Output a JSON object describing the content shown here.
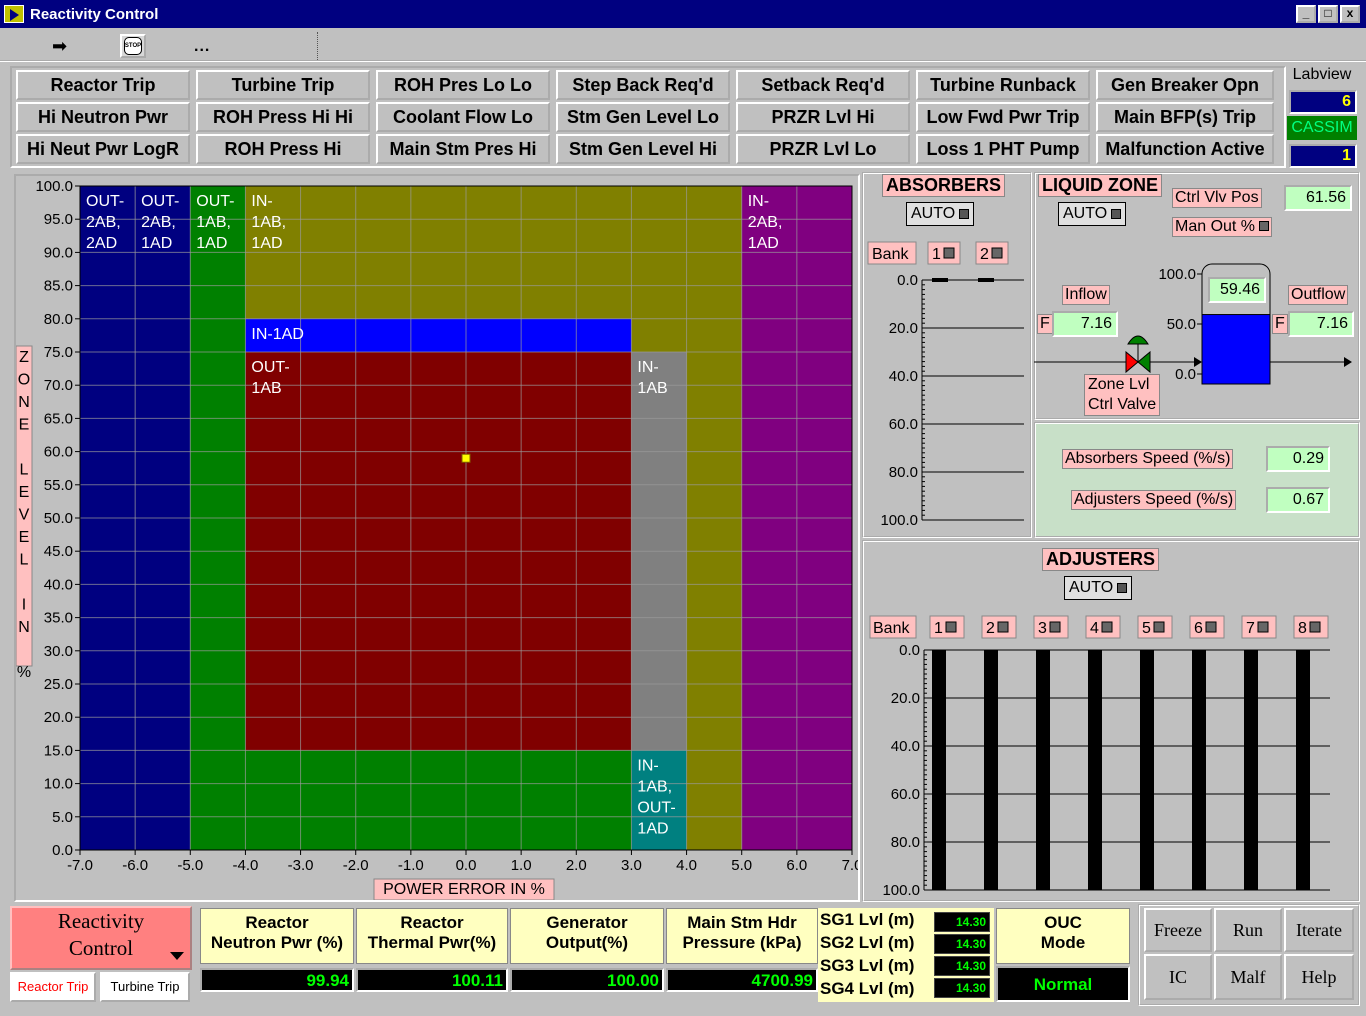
{
  "window": {
    "title": "Reactivity Control",
    "min": "_",
    "max": "□",
    "close": "x"
  },
  "toolbar": {
    "run_icon": "run-arrow-icon",
    "stop_label": "STOP",
    "more_label": "..."
  },
  "alarms": [
    [
      "Reactor Trip",
      "Turbine Trip",
      "ROH Pres Lo Lo",
      "Step Back Req'd",
      "Setback Req'd",
      "Turbine Runback",
      "Gen Breaker Opn"
    ],
    [
      "Hi Neutron Pwr",
      "ROH Press Hi Hi",
      "Coolant Flow Lo",
      "Stm Gen Level Lo",
      "PRZR Lvl Hi",
      "Low Fwd Pwr Trip",
      "Main BFP(s) Trip"
    ],
    [
      "Hi Neut Pwr LogR",
      "ROH Press Hi",
      "Main Stm Pres Hi",
      "Stm Gen Level Hi",
      "PRZR Lvl Lo",
      "Loss 1 PHT Pump",
      "Malfunction Active"
    ]
  ],
  "side": {
    "labview": "Labview",
    "labview_value": "6",
    "cassim": "CASSIM",
    "cassim_value": "1"
  },
  "chart_data": {
    "type": "heatmap",
    "xlabel": "POWER ERROR IN %",
    "ylabel": "ZONE LEVEL IN %",
    "xlim": [
      -7,
      7
    ],
    "ylim": [
      0,
      100
    ],
    "x_ticks": [
      "-7.0",
      "-6.0",
      "-5.0",
      "-4.0",
      "-3.0",
      "-2.0",
      "-1.0",
      "0.0",
      "1.0",
      "2.0",
      "3.0",
      "4.0",
      "5.0",
      "6.0",
      "7.0"
    ],
    "y_ticks": [
      "0.0",
      "5.0",
      "10.0",
      "15.0",
      "20.0",
      "25.0",
      "30.0",
      "35.0",
      "40.0",
      "45.0",
      "50.0",
      "55.0",
      "60.0",
      "65.0",
      "70.0",
      "75.0",
      "80.0",
      "85.0",
      "90.0",
      "95.0",
      "100.0"
    ],
    "grid": true,
    "regions": [
      {
        "x": [
          -7,
          -6
        ],
        "y": [
          0,
          100
        ],
        "color": "#000080",
        "label": [
          "OUT-",
          "2AB,",
          "2AD"
        ]
      },
      {
        "x": [
          -6,
          -5
        ],
        "y": [
          0,
          100
        ],
        "color": "#000080",
        "label": [
          "OUT-",
          "2AB,",
          "1AD"
        ]
      },
      {
        "x": [
          -5,
          -4
        ],
        "y": [
          0,
          100
        ],
        "color": "#008000",
        "label": [
          "OUT-",
          "1AB,",
          "1AD"
        ]
      },
      {
        "x": [
          -4,
          4
        ],
        "y": [
          0,
          15
        ],
        "color": "#008000",
        "label": []
      },
      {
        "x": [
          -4,
          5
        ],
        "y": [
          80,
          100
        ],
        "color": "#808000",
        "label": [
          "IN-",
          "1AB,",
          "1AD"
        ]
      },
      {
        "x": [
          3,
          5
        ],
        "y": [
          75,
          80
        ],
        "color": "#808000",
        "label": []
      },
      {
        "x": [
          4,
          5
        ],
        "y": [
          0,
          75
        ],
        "color": "#808000",
        "label": []
      },
      {
        "x": [
          -4,
          3
        ],
        "y": [
          75,
          80
        ],
        "color": "#0000ff",
        "label": [
          "IN-1AD"
        ]
      },
      {
        "x": [
          -4,
          3
        ],
        "y": [
          15,
          75
        ],
        "color": "#800000",
        "label": [
          "OUT-",
          "1AB"
        ]
      },
      {
        "x": [
          3,
          4
        ],
        "y": [
          15,
          75
        ],
        "color": "#808080",
        "label": [
          "IN-",
          "1AB"
        ]
      },
      {
        "x": [
          3,
          4
        ],
        "y": [
          0,
          15
        ],
        "color": "#008080",
        "label": [
          "IN-",
          "1AB,",
          "OUT-",
          "1AD"
        ]
      },
      {
        "x": [
          5,
          7
        ],
        "y": [
          0,
          100
        ],
        "color": "#800080",
        "label": [
          "IN-",
          "2AB,",
          "1AD"
        ]
      }
    ],
    "operating_point": {
      "x": 0.0,
      "y": 59.0,
      "color": "#ffff00"
    }
  },
  "absorbers": {
    "title": "ABSORBERS",
    "auto": "AUTO",
    "bank_label": "Bank",
    "banks": [
      "1",
      "2"
    ],
    "positions": [
      0.0,
      0.0
    ],
    "scale": [
      "0.0",
      "20.0",
      "40.0",
      "60.0",
      "80.0",
      "100.0"
    ]
  },
  "liquid_zone": {
    "title": "LIQUID ZONE",
    "auto": "AUTO",
    "ctrl_vlv_pos_label": "Ctrl Vlv Pos",
    "ctrl_vlv_pos": "61.56",
    "man_out_label": "Man Out %",
    "inflow_label": "Inflow",
    "inflow": "7.16",
    "inflow_f": "F",
    "outflow_label": "Outflow",
    "outflow": "7.16",
    "outflow_f": "F",
    "level": "59.46",
    "level_pct": 59.46,
    "scale": [
      "100.0",
      "50.0",
      "0.0"
    ],
    "valve_label1": "Zone Lvl",
    "valve_label2": "Ctrl Valve"
  },
  "speeds": {
    "absorbers_label": "Absorbers Speed (%/s)",
    "absorbers": "0.29",
    "adjusters_label": "Adjusters Speed (%/s)",
    "adjusters": "0.67"
  },
  "adjusters": {
    "title": "ADJUSTERS",
    "auto": "AUTO",
    "bank_label": "Bank",
    "banks": [
      "1",
      "2",
      "3",
      "4",
      "5",
      "6",
      "7",
      "8"
    ],
    "positions": [
      100,
      100,
      100,
      100,
      100,
      100,
      100,
      100
    ],
    "scale": [
      "0.0",
      "20.0",
      "40.0",
      "60.0",
      "80.0",
      "100.0"
    ]
  },
  "bottom": {
    "menu_title1": "Reactivity",
    "menu_title2": "Control",
    "tab_reactor_trip": "Reactor Trip",
    "tab_turbine_trip": "Turbine Trip",
    "neutron_label1": "Reactor",
    "neutron_label2": "Neutron Pwr (%)",
    "neutron": "99.94",
    "thermal_label1": "Reactor",
    "thermal_label2": "Thermal Pwr(%)",
    "thermal": "100.11",
    "gen_label1": "Generator",
    "gen_label2": "Output(%)",
    "gen": "100.00",
    "stm_label1": "Main Stm Hdr",
    "stm_label2": "Pressure (kPa)",
    "stm": "4700.99",
    "sg": [
      {
        "label": "SG1 Lvl (m)",
        "value": "14.30"
      },
      {
        "label": "SG2 Lvl (m)",
        "value": "14.30"
      },
      {
        "label": "SG3 Lvl (m)",
        "value": "14.30"
      },
      {
        "label": "SG4 Lvl (m)",
        "value": "14.30"
      }
    ],
    "ouc_label1": "OUC",
    "ouc_label2": "Mode",
    "ouc": "Normal"
  },
  "controls": {
    "freeze": "Freeze",
    "run": "Run",
    "iterate": "Iterate",
    "ic": "IC",
    "malf": "Malf",
    "help": "Help"
  }
}
